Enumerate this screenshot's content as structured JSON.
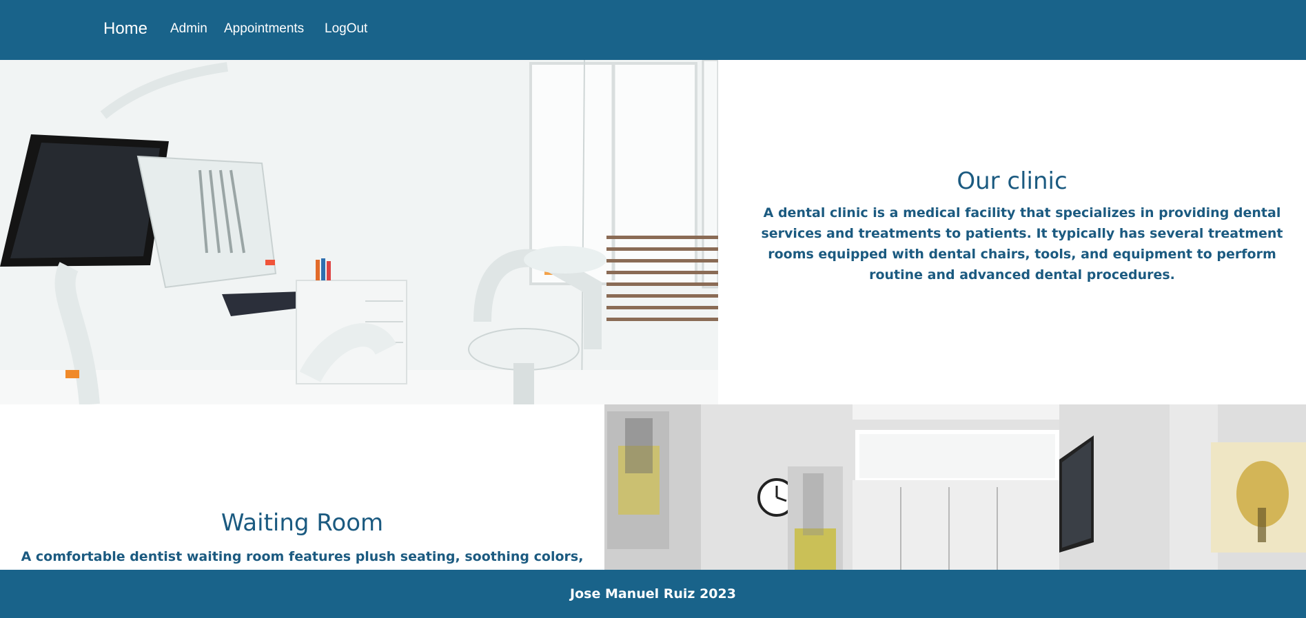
{
  "nav": {
    "brand": "Home",
    "links": [
      "Admin",
      "Appointments",
      "LogOut"
    ]
  },
  "clinic": {
    "title": "Our clinic",
    "body": "A dental clinic is a medical facility that specializes in providing dental services and treatments to patients. It typically has several treatment rooms equipped with dental chairs, tools, and equipment to perform routine and advanced dental procedures."
  },
  "waiting": {
    "title": "Waiting Room",
    "body": "A comfortable dentist waiting room features plush seating, soothing colors, and soft"
  },
  "footer": {
    "text": "Jose Manuel Ruiz 2023"
  },
  "colors": {
    "brand_blue": "#19638a",
    "heading_blue": "#1b5a80",
    "background": "#ffffff"
  }
}
